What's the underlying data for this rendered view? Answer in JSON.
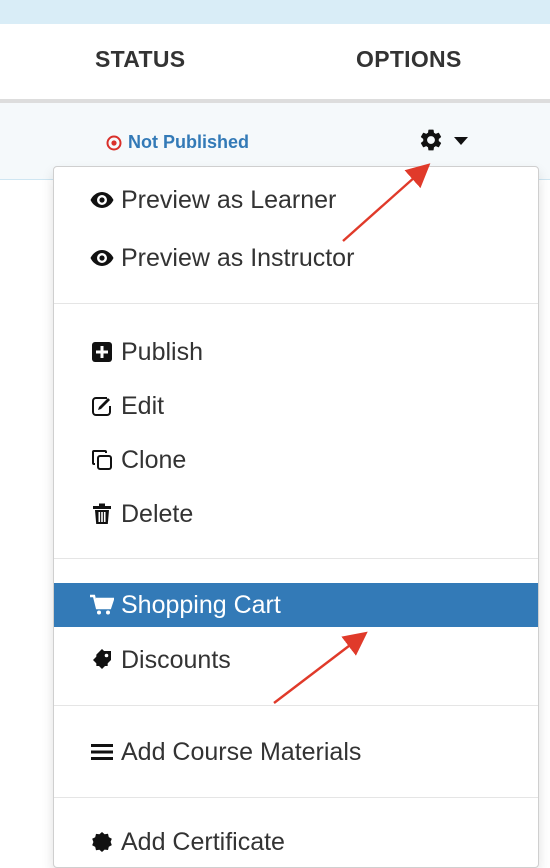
{
  "table": {
    "headers": {
      "status": "STATUS",
      "options": "OPTIONS"
    },
    "row": {
      "status_label": "Not Published",
      "status_color": "#d9302a",
      "options_icon": "gear-icon"
    }
  },
  "menu": {
    "groups": [
      [
        {
          "label": "Preview as Learner",
          "icon": "eye-icon"
        },
        {
          "label": "Preview as Instructor",
          "icon": "eye-icon"
        }
      ],
      [
        {
          "label": "Publish",
          "icon": "plus-square-icon"
        },
        {
          "label": "Edit",
          "icon": "edit-icon"
        },
        {
          "label": "Clone",
          "icon": "clone-icon"
        },
        {
          "label": "Delete",
          "icon": "trash-icon"
        }
      ],
      [
        {
          "label": "Shopping Cart",
          "icon": "cart-icon",
          "active": true
        },
        {
          "label": "Discounts",
          "icon": "tag-icon"
        }
      ],
      [
        {
          "label": "Add Course Materials",
          "icon": "bars-icon"
        }
      ],
      [
        {
          "label": "Add Certificate",
          "icon": "certificate-icon"
        }
      ]
    ],
    "active_color": "#337ab7"
  },
  "annotations": {
    "arrow_color": "#e03a2a"
  }
}
